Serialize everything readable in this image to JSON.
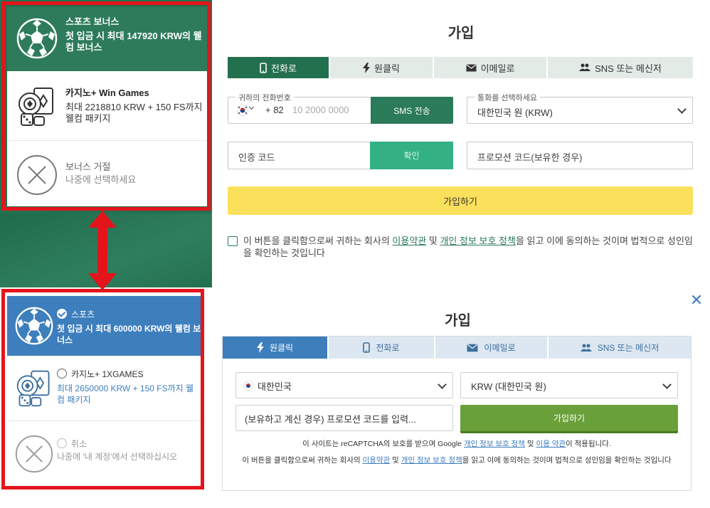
{
  "top": {
    "bonuses": {
      "sports": {
        "title": "스포츠 보너스",
        "desc": "첫 입금 시 최대 147920 KRW의 웰컴 보너스"
      },
      "casino": {
        "title": "카지노+ Win Games",
        "desc": "최대 2218810 KRW + 150 FS까지 웰컴 패키지"
      },
      "decline": {
        "title": "보너스 거절",
        "desc": "나중에 선택하세요"
      }
    },
    "title": "가입",
    "tabs": [
      "전화로",
      "원클릭",
      "이메일로",
      "SNS 또는 메신저"
    ],
    "phone": {
      "label": "귀하의 전화번호",
      "code": "+ 82",
      "placeholder": "10 2000 0000",
      "sms": "SMS 전송"
    },
    "currency": {
      "label": "통화를 선택하세요",
      "value": "대한민국 원 (KRW)"
    },
    "code": {
      "placeholder": "인증 코드",
      "confirm": "확인"
    },
    "promo": {
      "placeholder": "프로모션 코드(보유한 경우)"
    },
    "join": "가입하기",
    "agree": {
      "pre": "이 버튼을 클릭함으로써 귀하는 회사의 ",
      "terms": "이용약관",
      "mid": " 및 ",
      "privacy": "개인 정보 보호 정책",
      "post": "을 읽고 이에 동의하는 것이며 법적으로 성인임을 확인하는 것입니다"
    }
  },
  "bottom": {
    "bonuses": {
      "sports": {
        "title": "스포츠",
        "desc": "첫 입금 시 최대 600000 KRW의 웰컴 보너스"
      },
      "casino": {
        "title": "카지노+ 1XGAMES",
        "desc": "최대 2650000 KRW + 150 FS까지 웰컴 패키지"
      },
      "cancel": {
        "title": "취소",
        "desc": "나중에 '내 계정'에서 선택하십시오"
      }
    },
    "close": "✕",
    "title": "가입",
    "tabs": [
      "원클릭",
      "전화로",
      "이메일로",
      "SNS 또는 메신저"
    ],
    "country": "대한민국",
    "currency": "KRW (대한민국 원)",
    "promo": "(보유하고 계신 경우) 프로모션 코드를 입력...",
    "join": "가입하기",
    "recaptcha": {
      "pre": "이 사이트는 reCAPTCHA의 보호를 받으며 Google ",
      "privacy": "개인 정보 보호 정책",
      "mid": " 및 ",
      "terms": "이용 약관",
      "post": "이 적용됩니다."
    },
    "agree": {
      "pre": "이 버튼을 클릭함으로써 귀하는 회사의 ",
      "terms": "이용약관",
      "mid": " 및 ",
      "privacy": "개인 정보 보호 정책",
      "post": "을 읽고 이에 동의하는 것이며 법적으로 성인임을 확인하는 것입니다"
    }
  },
  "colors": {
    "green": "#23704f",
    "yellow": "#fbe05c",
    "blue": "#3d7ebd",
    "lime": "#6aa03a",
    "red": "#e4141b"
  },
  "icons": [
    "soccer-ball-icon",
    "casino-chips-cards-icon",
    "circle-x-icon",
    "phone-icon",
    "lightning-icon",
    "envelope-icon",
    "people-icon",
    "korea-flag-icon",
    "chevron-down-icon",
    "double-arrow-icon",
    "close-icon",
    "check-icon"
  ]
}
